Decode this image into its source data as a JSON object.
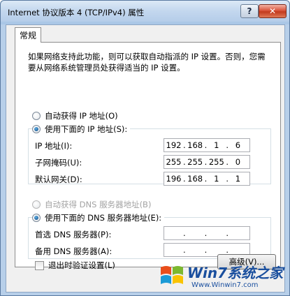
{
  "window": {
    "title": "Internet 协议版本 4 (TCP/IPv4) 属性",
    "help_label": "?",
    "close_label": "✕"
  },
  "tabs": [
    {
      "label": "常规"
    }
  ],
  "description": "如果网络支持此功能，则可以获取自动指派的 IP 设置。否则，您需要从网络系统管理员处获得适当的 IP 设置。",
  "ip_section": {
    "auto_label": "自动获得 IP 地址(O)",
    "manual_label": "使用下面的 IP 地址(S):",
    "manual_selected": true,
    "fields": [
      {
        "label": "IP 地址(I):",
        "octets": [
          "192",
          "168",
          "1",
          "6"
        ]
      },
      {
        "label": "子网掩码(U):",
        "octets": [
          "255",
          "255",
          "255",
          "0"
        ]
      },
      {
        "label": "默认网关(D):",
        "octets": [
          "196",
          "168",
          "1",
          "1"
        ]
      }
    ]
  },
  "dns_section": {
    "auto_label": "自动获得 DNS 服务器地址(B)",
    "manual_label": "使用下面的 DNS 服务器地址(E):",
    "manual_selected": true,
    "fields": [
      {
        "label": "首选 DNS 服务器(P):",
        "octets": [
          "",
          "",
          "",
          ""
        ]
      },
      {
        "label": "备用 DNS 服务器(A):",
        "octets": [
          "",
          "",
          "",
          ""
        ]
      }
    ]
  },
  "validate_on_exit": {
    "label": "退出时验证设置(L)",
    "checked": false
  },
  "advanced_button": {
    "label": "高级(V)..."
  },
  "watermark": {
    "brand": "Win7系统之家",
    "url": "Www.Winwin7.com"
  },
  "colors": {
    "accent_blue": "#1a4f9e",
    "close_red": "#c23a1d"
  }
}
